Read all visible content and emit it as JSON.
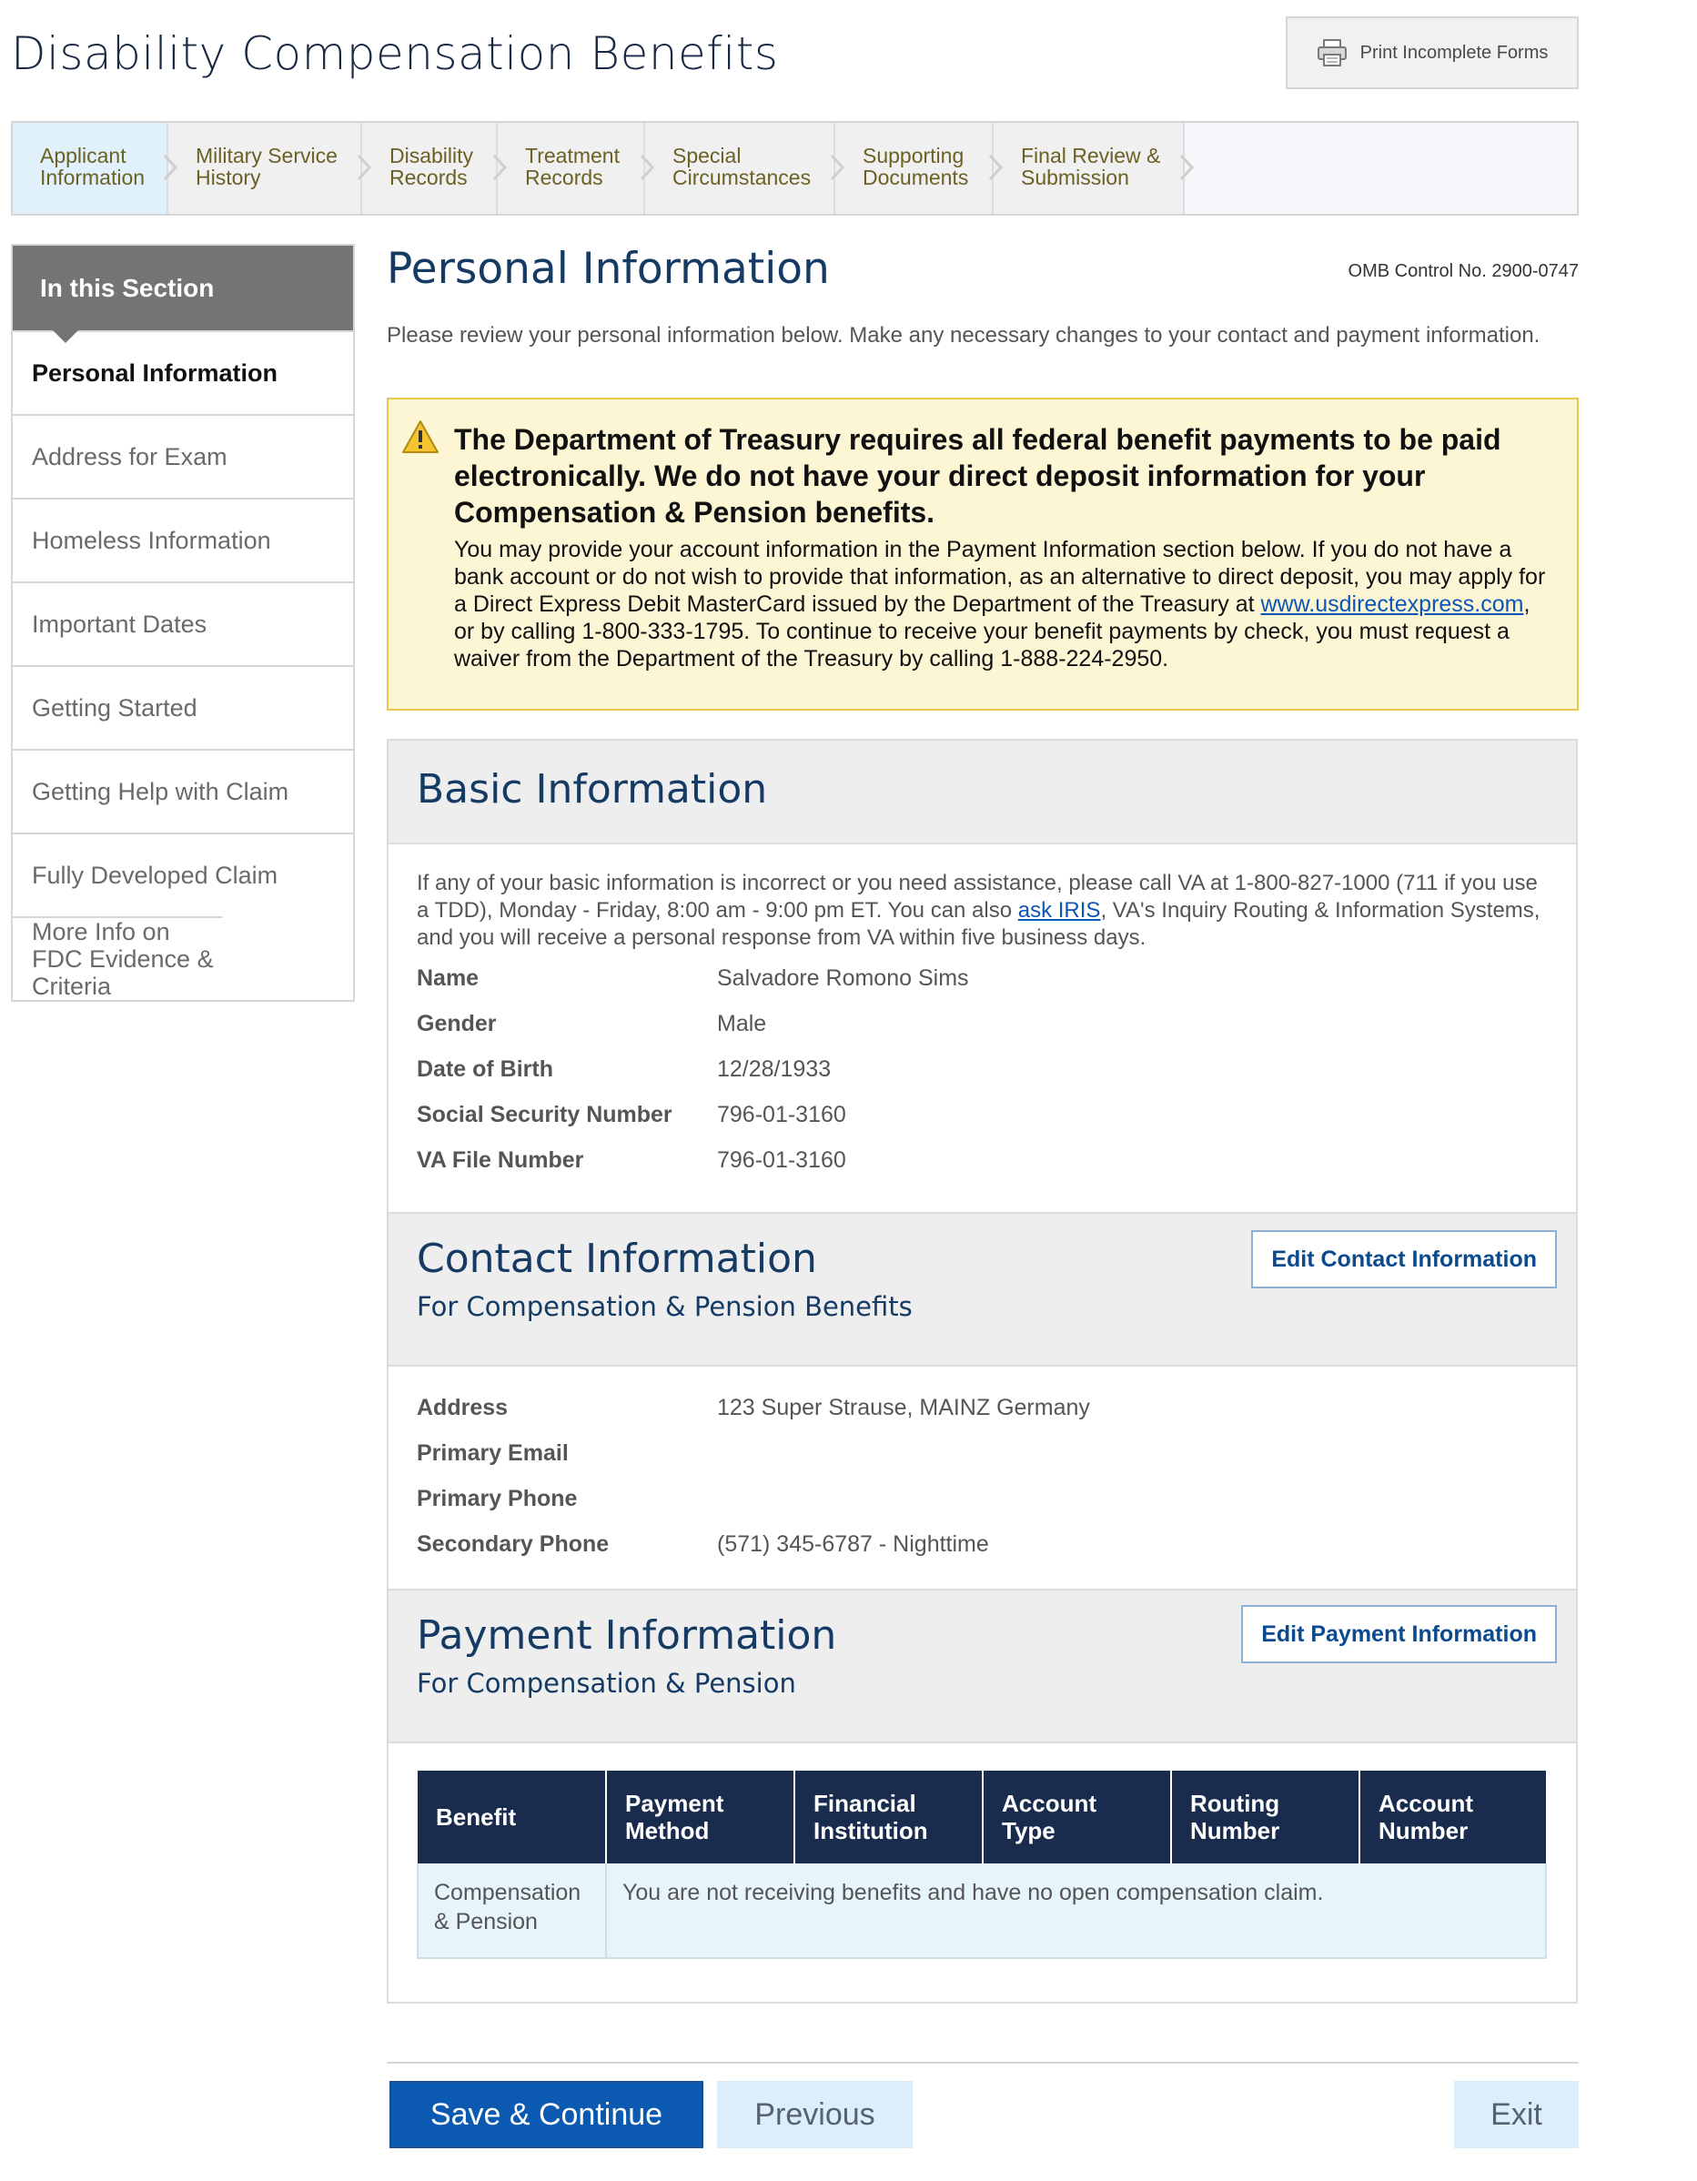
{
  "header": {
    "title": "Disability Compensation Benefits",
    "print_label": "Print Incomplete Forms"
  },
  "steps": [
    {
      "line1": "Applicant",
      "line2": "Information"
    },
    {
      "line1": "Military Service",
      "line2": "History"
    },
    {
      "line1": "Disability",
      "line2": "Records"
    },
    {
      "line1": "Treatment",
      "line2": "Records"
    },
    {
      "line1": "Special",
      "line2": "Circumstances"
    },
    {
      "line1": "Supporting",
      "line2": "Documents"
    },
    {
      "line1": "Final Review &",
      "line2": "Submission"
    }
  ],
  "sidebar": {
    "heading": "In this Section",
    "items": [
      {
        "label": "Personal Information"
      },
      {
        "label": "Address for Exam"
      },
      {
        "label": "Homeless Information"
      },
      {
        "label": "Important Dates"
      },
      {
        "label": "Getting Started"
      },
      {
        "label": "Getting Help with Claim"
      },
      {
        "label": "Fully Developed Claim"
      },
      {
        "label": "More Info on FDC Evidence & Criteria"
      }
    ]
  },
  "main": {
    "title": "Personal Information",
    "omb": "OMB Control No. 2900-0747",
    "intro": "Please review your personal information below. Make any necessary changes to your contact and payment information."
  },
  "alert": {
    "title": "The Department of Treasury requires all federal benefit payments to be paid electronically. We do not have your direct deposit information for your Compensation & Pension benefits.",
    "body_before": "You may provide your account information in the Payment Information section below. If you do not have a bank account or do not wish to provide that information, as an alternative to direct deposit, you may apply for a Direct Express Debit MasterCard issued by the Department of the Treasury at ",
    "link": "www.usdirectexpress.com",
    "body_after": ", or by calling 1-800-333-1795. To continue to receive your benefit payments by check, you must request a waiver from the Department of the Treasury by calling 1-888-224-2950."
  },
  "basic": {
    "title": "Basic Information",
    "help_before": "If any of your basic information is incorrect or you need assistance, please call VA at 1-800-827-1000 (711 if you use a TDD), Monday - Friday, 8:00 am - 9:00 pm ET. You can also ",
    "help_link": "ask IRIS",
    "help_after": ", VA's Inquiry Routing & Information Systems, and you will receive a personal response from VA within five business days.",
    "fields": [
      {
        "label": "Name",
        "value": "Salvadore Romono Sims"
      },
      {
        "label": "Gender",
        "value": "Male"
      },
      {
        "label": "Date of Birth",
        "value": "12/28/1933"
      },
      {
        "label": "Social Security Number",
        "value": "796-01-3160"
      },
      {
        "label": "VA File Number",
        "value": "796-01-3160"
      }
    ]
  },
  "contact": {
    "title": "Contact Information",
    "subtitle": "For Compensation & Pension Benefits",
    "edit_label": "Edit Contact Information",
    "fields": [
      {
        "label": "Address",
        "value": "123 Super Strause, MAINZ Germany"
      },
      {
        "label": "Primary Email",
        "value": ""
      },
      {
        "label": "Primary Phone",
        "value": ""
      },
      {
        "label": "Secondary Phone",
        "value": "(571) 345-6787 - Nighttime"
      }
    ]
  },
  "payment": {
    "title": "Payment Information",
    "subtitle": "For Compensation & Pension",
    "edit_label": "Edit Payment Information",
    "columns": [
      {
        "line1": "Benefit",
        "line2": ""
      },
      {
        "line1": "Payment",
        "line2": "Method"
      },
      {
        "line1": "Financial",
        "line2": "Institution"
      },
      {
        "line1": "Account",
        "line2": "Type"
      },
      {
        "line1": "Routing",
        "line2": "Number"
      },
      {
        "line1": "Account",
        "line2": "Number"
      }
    ],
    "row_benefit_line1": "Compensation",
    "row_benefit_line2": "& Pension",
    "row_message": "You are not receiving benefits and have no open compensation claim."
  },
  "footer": {
    "save_label": "Save & Continue",
    "previous_label": "Previous",
    "exit_label": "Exit"
  },
  "colors": {
    "navy": "#1a2c4e",
    "heading_blue": "#153b64",
    "primary_button": "#0c59b2",
    "alert_bg": "#fcf6d5",
    "alert_border": "#ecc54a",
    "active_step": "#e1f1fb"
  }
}
